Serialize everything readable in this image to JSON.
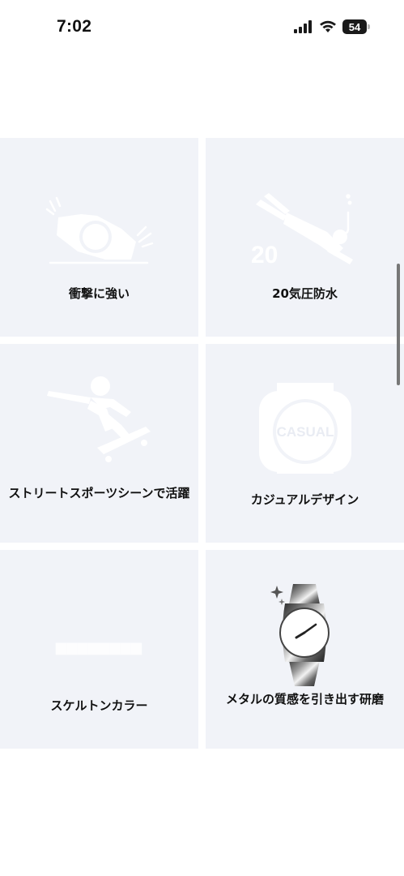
{
  "status_bar": {
    "time": "7:02",
    "battery": "54",
    "icons": [
      "signal-icon",
      "wifi-icon",
      "battery-icon"
    ]
  },
  "features": [
    {
      "label": "衝撃に強い",
      "icon": "shock-resist-icon"
    },
    {
      "label": "20気圧防水",
      "icon": "diver-icon",
      "badge": "20"
    },
    {
      "label": "ストリートスポーツシーンで活躍",
      "icon": "skateboarder-icon"
    },
    {
      "label": "カジュアルデザイン",
      "icon": "casual-watch-icon",
      "badge": "CASUAL"
    },
    {
      "label": "スケルトンカラー",
      "icon": "skeleton-watch-icon"
    },
    {
      "label": "メタルの質感を引き出す研磨",
      "icon": "metal-watch-icon"
    }
  ],
  "colors": {
    "tile_bg": "#f1f3f8",
    "page_bg": "#ffffff",
    "text": "#111111"
  }
}
